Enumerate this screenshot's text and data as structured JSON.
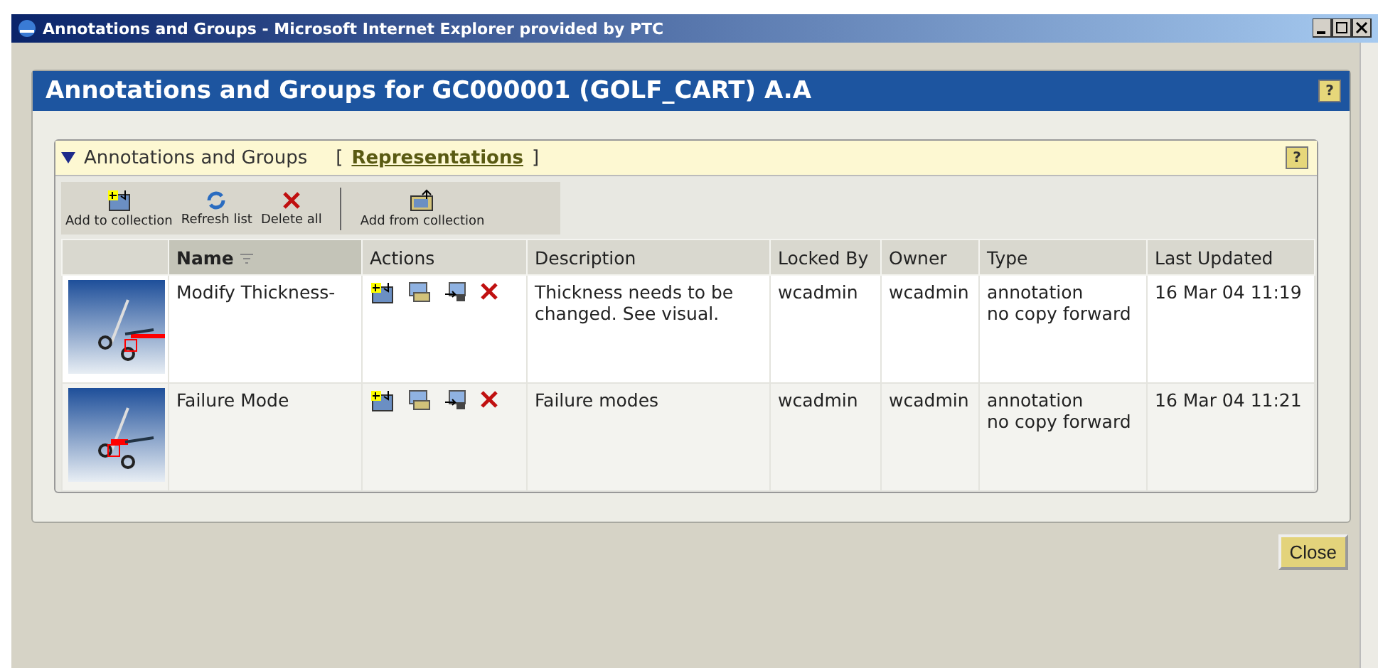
{
  "window": {
    "title": "Annotations and Groups - Microsoft Internet Explorer provided by PTC"
  },
  "page": {
    "title": "Annotations and Groups for GC000001 (GOLF_CART) A.A",
    "help": "?"
  },
  "section": {
    "title": "Annotations and Groups",
    "expanded": true,
    "link_open": "[",
    "link": "Representations",
    "link_close": "]",
    "help": "?"
  },
  "toolbar": [
    {
      "label": "Add to collection",
      "kind": "add"
    },
    {
      "label": "Refresh list",
      "kind": "refresh"
    },
    {
      "label": "Delete all",
      "kind": "delete"
    },
    {
      "label": "Add from collection",
      "kind": "addfrom"
    }
  ],
  "columns": [
    {
      "sorted": false
    },
    {
      "label": "Name",
      "sorted": true
    },
    {
      "label": "Actions",
      "sorted": false
    },
    {
      "label": "Description",
      "sorted": false
    },
    {
      "label": "Locked By",
      "sorted": false
    },
    {
      "label": "Owner",
      "sorted": false
    },
    {
      "label": "Type",
      "sorted": false
    },
    {
      "label": "Last Updated",
      "sorted": false
    }
  ],
  "rows": [
    {
      "name": "Modify Thickness-",
      "description": "Thickness needs to be changed. See visual.",
      "locked_by": "wcadmin",
      "owner": "wcadmin",
      "type": [
        "annotation",
        "no copy forward"
      ],
      "last_updated": "16 Mar 04 11:19"
    },
    {
      "name": "Failure Mode",
      "description": "Failure modes",
      "locked_by": "wcadmin",
      "owner": "wcadmin",
      "type": [
        "annotation",
        "no copy forward"
      ],
      "last_updated": "16 Mar 04 11:21"
    }
  ],
  "buttons": [
    "Close"
  ]
}
